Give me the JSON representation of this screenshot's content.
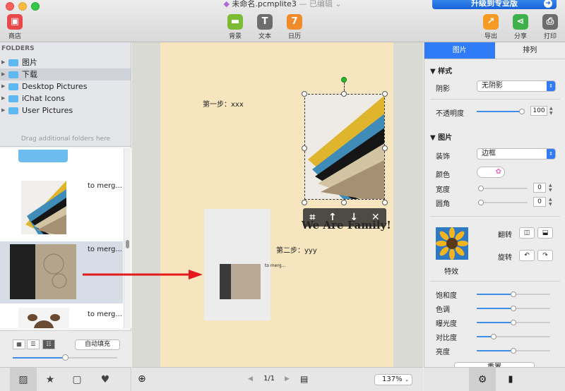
{
  "window": {
    "title": "未命名.pcmplite3",
    "title_suffix": " — 已编辑 ⌄",
    "upgrade_label": "升级到专业版",
    "upgrade_arrow": "➜"
  },
  "toolbar": {
    "store": "商店",
    "background": "背景",
    "text": "文本",
    "calendar": "日历",
    "calendar_icon_day": "7",
    "text_icon": "T",
    "export": "导出",
    "share": "分享",
    "print": "打印"
  },
  "folders": {
    "title": "FOLDERS",
    "items": [
      {
        "label": "图片",
        "selected": false
      },
      {
        "label": "下载",
        "selected": true
      },
      {
        "label": "Desktop Pictures",
        "selected": false
      },
      {
        "label": "iChat Icons",
        "selected": false
      },
      {
        "label": "User Pictures",
        "selected": false
      }
    ],
    "drag_hint": "Drag additional folders here"
  },
  "thumbnails": [
    {
      "label": "to merg..."
    },
    {
      "label": "to merg..."
    },
    {
      "label": "to merg..."
    }
  ],
  "left_controls": {
    "autofill": "自动填充",
    "thumb_size": 0.5
  },
  "canvas": {
    "step1": "第一步：xxx",
    "step2": "第二步：yyy",
    "heading": "We Are Family!",
    "photo2_caption": "to merg...",
    "toolbar": {
      "crop": "⌗",
      "up": "↑",
      "down": "↓",
      "close": "✕"
    }
  },
  "bottom": {
    "page_indicator": "1/1",
    "zoom": "137%",
    "prev": "◀",
    "next": "▶"
  },
  "right_panel": {
    "tabs": [
      {
        "label": "图片",
        "selected": true
      },
      {
        "label": "排列",
        "selected": false
      }
    ],
    "style_section": "样式",
    "shadow_label": "阴影",
    "shadow_value": "无阴影",
    "opacity_label": "不透明度",
    "opacity_value": "100",
    "image_section": "图片",
    "decoration_label": "装饰",
    "decoration_value": "边框",
    "color_label": "颜色",
    "width_label": "宽度",
    "width_value": "0",
    "radius_label": "圆角",
    "radius_value": "0",
    "flip_label": "翻转",
    "rotate_label": "旋转",
    "effects_label": "特效",
    "saturation_label": "饱和度",
    "hue_label": "色调",
    "exposure_label": "曝光度",
    "contrast_label": "对比度",
    "brightness_label": "亮度",
    "reset": "重置",
    "levels": {
      "opacity": 1.0,
      "saturation": 0.5,
      "hue": 0.5,
      "exposure": 0.5,
      "contrast": 0.23,
      "brightness": 0.5
    }
  },
  "colors": {
    "accent": "#2f7cf6",
    "page": "#f7e5bf",
    "arrow": "#e3191b"
  }
}
